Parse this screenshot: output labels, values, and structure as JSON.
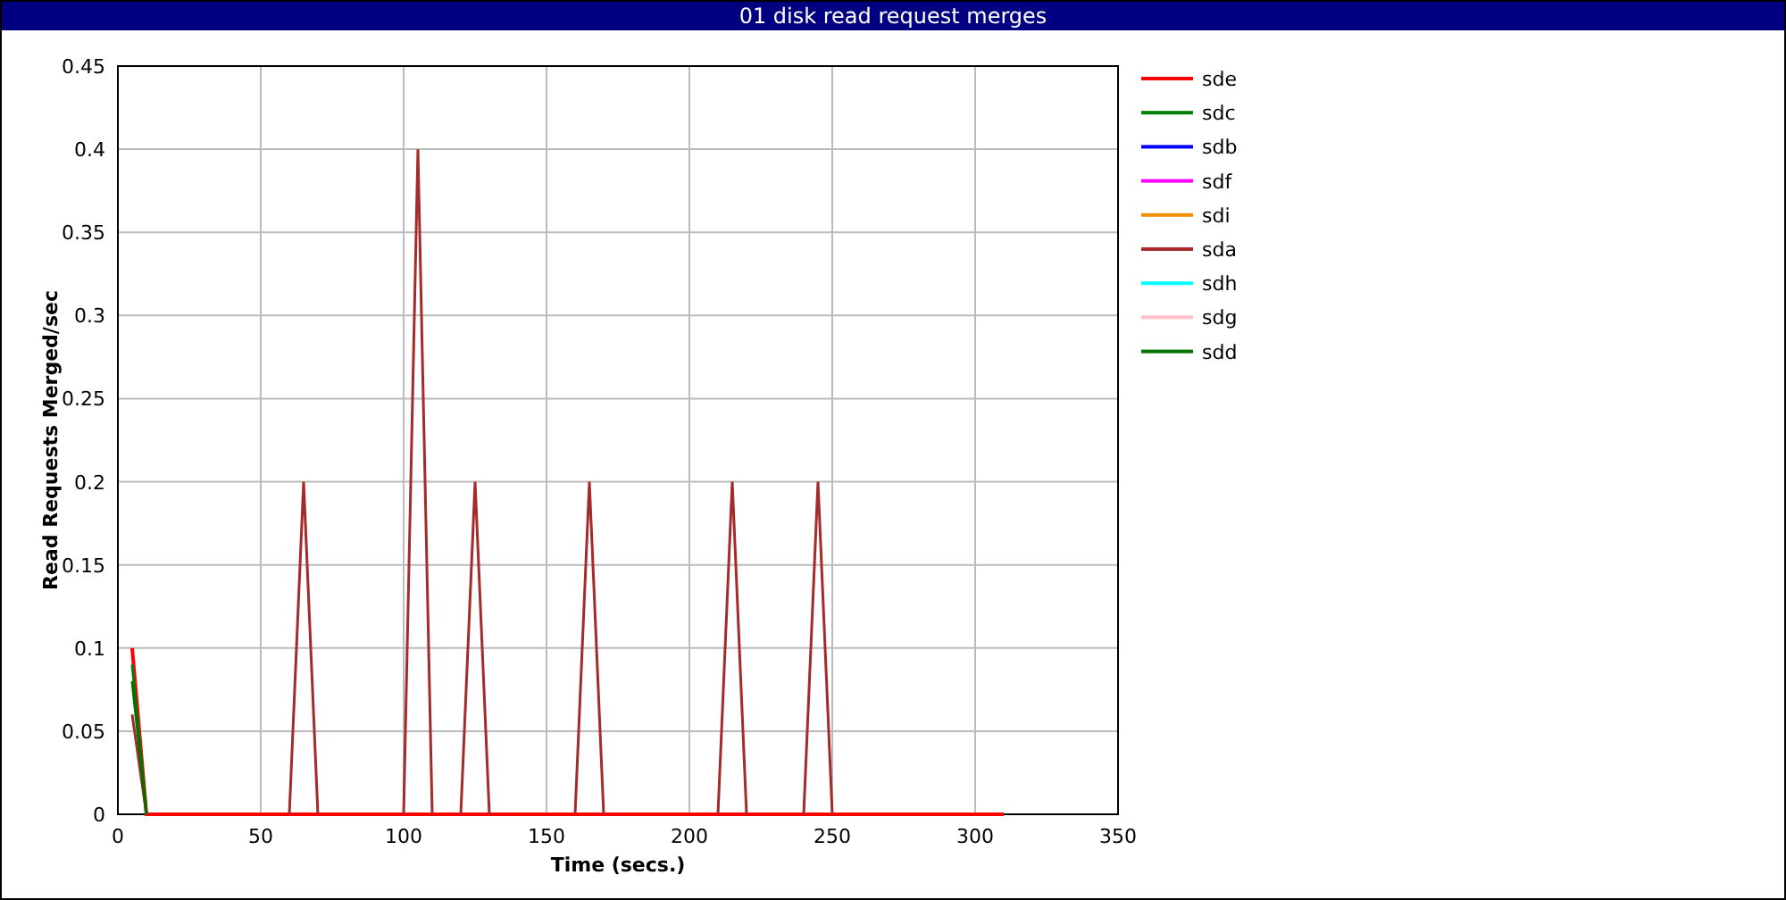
{
  "title": "01 disk read request merges",
  "chart": {
    "chart_data": {
      "type": "line",
      "xlabel": "Time (secs.)",
      "ylabel": "Read Requests Merged/sec",
      "grid": true,
      "legend": true,
      "xlim": [
        0,
        350
      ],
      "ylim": [
        0,
        0.45
      ],
      "xticks": [
        0,
        50,
        100,
        150,
        200,
        250,
        300,
        350
      ],
      "yticks": [
        0,
        0.05,
        0.1,
        0.15,
        0.2,
        0.25,
        0.3,
        0.35,
        0.4,
        0.45
      ],
      "x": [
        5,
        10,
        15,
        20,
        25,
        30,
        35,
        40,
        45,
        50,
        55,
        60,
        65,
        70,
        75,
        80,
        85,
        90,
        95,
        100,
        105,
        110,
        115,
        120,
        125,
        130,
        135,
        140,
        145,
        150,
        155,
        160,
        165,
        170,
        175,
        180,
        185,
        190,
        195,
        200,
        205,
        210,
        215,
        220,
        225,
        230,
        235,
        240,
        245,
        250,
        255,
        260,
        265,
        270,
        275,
        280,
        285,
        290,
        295,
        300,
        305,
        310
      ],
      "series": [
        {
          "name": "sde",
          "color": "#ff0000",
          "values": [
            0.1,
            0,
            0,
            0,
            0,
            0,
            0,
            0,
            0,
            0,
            0,
            0,
            0,
            0,
            0,
            0,
            0,
            0,
            0,
            0,
            0,
            0,
            0,
            0,
            0,
            0,
            0,
            0,
            0,
            0,
            0,
            0,
            0,
            0,
            0,
            0,
            0,
            0,
            0,
            0,
            0,
            0,
            0,
            0,
            0,
            0,
            0,
            0,
            0,
            0,
            0,
            0,
            0,
            0,
            0,
            0,
            0,
            0,
            0,
            0,
            0,
            0
          ]
        },
        {
          "name": "sdc",
          "color": "#008000",
          "values": [
            0.09,
            0,
            null,
            null,
            null,
            null,
            null,
            null,
            null,
            null,
            null,
            null,
            null,
            null,
            null,
            null,
            null,
            null,
            null,
            null,
            null,
            null,
            null,
            null,
            null,
            null,
            null,
            null,
            null,
            null,
            null,
            null,
            null,
            null,
            null,
            null,
            null,
            null,
            null,
            null,
            null,
            null,
            null,
            null,
            null,
            null,
            null,
            null,
            null,
            null,
            null,
            null,
            null,
            null,
            null,
            null,
            null,
            null,
            null,
            null,
            null,
            null
          ]
        },
        {
          "name": "sdb",
          "color": "#0000ff",
          "values": [
            null,
            null,
            null,
            null,
            null,
            null,
            null,
            null,
            null,
            null,
            null,
            null,
            null,
            null,
            null,
            null,
            null,
            null,
            null,
            null,
            null,
            null,
            null,
            null,
            null,
            null,
            null,
            null,
            null,
            null,
            null,
            null,
            null,
            null,
            null,
            null,
            null,
            null,
            null,
            null,
            null,
            null,
            null,
            null,
            null,
            null,
            null,
            null,
            null,
            null,
            null,
            null,
            null,
            null,
            null,
            null,
            null,
            null,
            null,
            null,
            null,
            null
          ]
        },
        {
          "name": "sdf",
          "color": "#ff00ff",
          "values": [
            null,
            null,
            null,
            null,
            null,
            null,
            null,
            null,
            null,
            null,
            null,
            null,
            null,
            null,
            null,
            null,
            null,
            null,
            null,
            null,
            null,
            null,
            null,
            null,
            null,
            null,
            null,
            null,
            null,
            null,
            null,
            null,
            null,
            null,
            null,
            null,
            null,
            null,
            null,
            null,
            null,
            null,
            null,
            null,
            null,
            null,
            null,
            null,
            null,
            null,
            null,
            null,
            null,
            null,
            null,
            null,
            null,
            null,
            null,
            null,
            null,
            null
          ]
        },
        {
          "name": "sdi",
          "color": "#f09000",
          "values": [
            null,
            null,
            null,
            null,
            null,
            null,
            null,
            null,
            null,
            null,
            null,
            null,
            null,
            null,
            null,
            null,
            null,
            null,
            null,
            null,
            null,
            null,
            null,
            null,
            null,
            null,
            null,
            null,
            null,
            null,
            null,
            null,
            null,
            null,
            null,
            null,
            null,
            null,
            null,
            null,
            null,
            null,
            null,
            null,
            null,
            null,
            null,
            null,
            null,
            null,
            null,
            null,
            null,
            null,
            null,
            null,
            null,
            null,
            null,
            null,
            null,
            null
          ]
        },
        {
          "name": "sda",
          "color": "#a52a2a",
          "values": [
            0.06,
            0,
            null,
            null,
            null,
            null,
            null,
            null,
            null,
            null,
            null,
            0,
            0.2,
            0,
            null,
            null,
            null,
            null,
            null,
            0,
            0.4,
            0,
            null,
            0,
            0.2,
            0,
            null,
            null,
            null,
            null,
            null,
            0,
            0.2,
            0,
            null,
            null,
            null,
            null,
            null,
            null,
            null,
            0,
            0.2,
            0,
            null,
            null,
            null,
            0,
            0.2,
            0,
            null,
            null,
            null,
            null,
            null,
            null,
            null,
            null,
            null,
            null,
            null,
            null
          ]
        },
        {
          "name": "sdh",
          "color": "#00ffff",
          "values": [
            null,
            null,
            null,
            null,
            null,
            null,
            null,
            null,
            null,
            null,
            null,
            null,
            null,
            null,
            null,
            null,
            null,
            null,
            null,
            null,
            null,
            null,
            null,
            null,
            null,
            null,
            null,
            null,
            null,
            null,
            null,
            null,
            null,
            null,
            null,
            null,
            null,
            null,
            null,
            null,
            null,
            null,
            null,
            null,
            null,
            null,
            null,
            null,
            null,
            null,
            null,
            null,
            null,
            null,
            null,
            null,
            null,
            null,
            null,
            null,
            null,
            null
          ]
        },
        {
          "name": "sdg",
          "color": "#ffc0cb",
          "values": [
            null,
            null,
            null,
            null,
            null,
            null,
            null,
            null,
            null,
            null,
            null,
            null,
            null,
            null,
            null,
            null,
            null,
            null,
            null,
            null,
            null,
            null,
            null,
            null,
            null,
            null,
            null,
            null,
            null,
            null,
            null,
            null,
            null,
            null,
            null,
            null,
            null,
            null,
            null,
            null,
            null,
            null,
            null,
            null,
            null,
            null,
            null,
            null,
            null,
            null,
            null,
            null,
            null,
            null,
            null,
            null,
            null,
            null,
            null,
            null,
            null,
            null
          ]
        },
        {
          "name": "sdd",
          "color": "#007000",
          "values": [
            0.08,
            0,
            null,
            null,
            null,
            null,
            null,
            null,
            null,
            null,
            null,
            null,
            null,
            null,
            null,
            null,
            null,
            null,
            null,
            null,
            null,
            null,
            null,
            null,
            null,
            null,
            null,
            null,
            null,
            null,
            null,
            null,
            null,
            null,
            null,
            null,
            null,
            null,
            null,
            null,
            null,
            null,
            null,
            null,
            null,
            null,
            null,
            null,
            null,
            null,
            null,
            null,
            null,
            null,
            null,
            null,
            null,
            null,
            null,
            null,
            null,
            null
          ]
        }
      ]
    }
  }
}
